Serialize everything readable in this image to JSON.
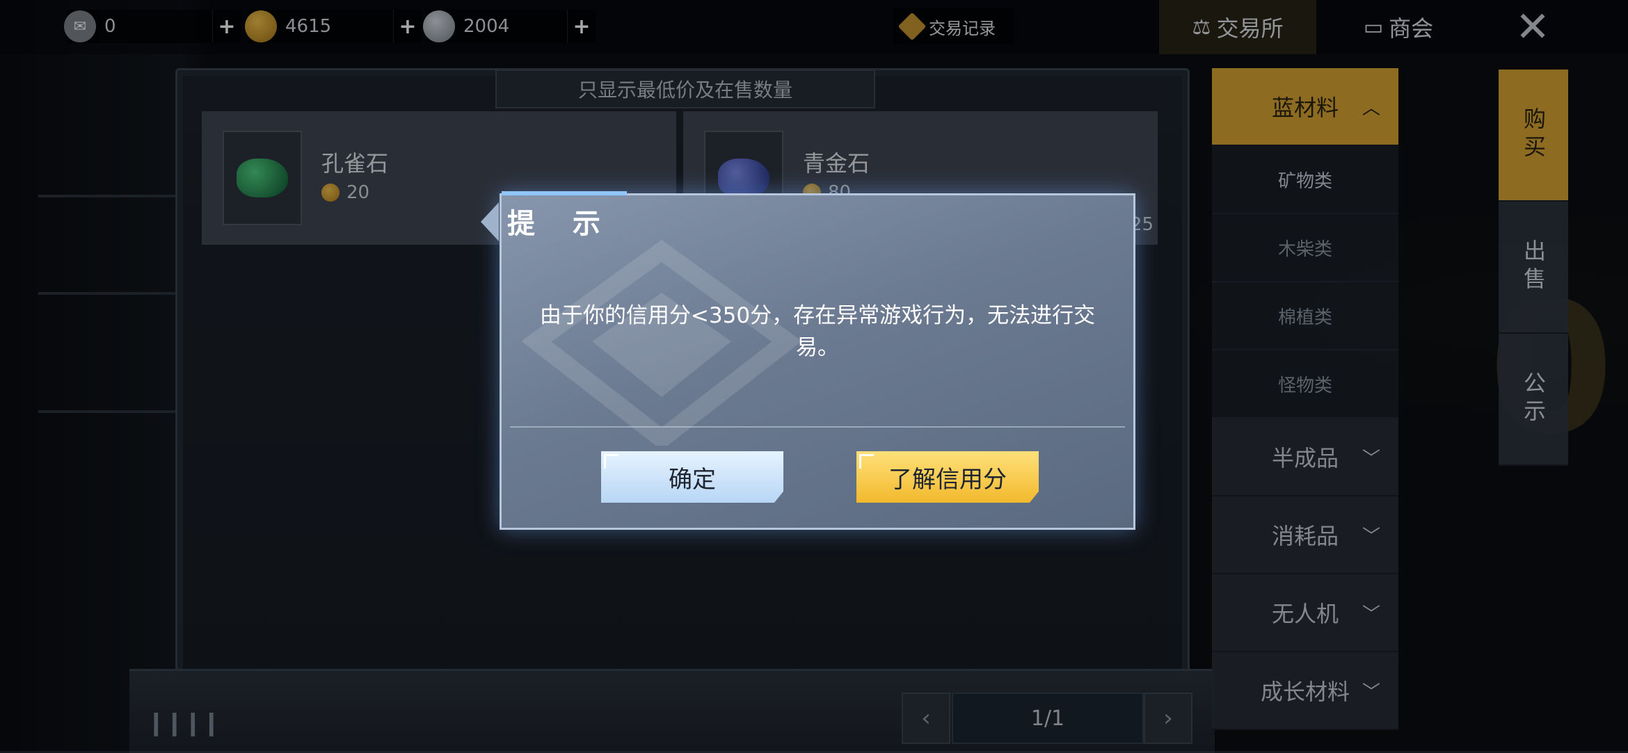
{
  "currency": [
    {
      "icon": "ticket-icon",
      "value": "0"
    },
    {
      "icon": "gold-coin-icon",
      "value": "4615"
    },
    {
      "icon": "silver-coin-icon",
      "value": "2004"
    }
  ],
  "topbar": {
    "trade_record": "交易记录",
    "tabs": [
      {
        "label": "交易所",
        "icon": "scale-icon"
      },
      {
        "label": "商会",
        "icon": "shop-icon"
      }
    ]
  },
  "panel": {
    "filter_label": "只显示最低价及在售数量",
    "items": [
      {
        "name": "孔雀石",
        "price": "20",
        "count": ""
      },
      {
        "name": "青金石",
        "price": "80",
        "count": "25"
      }
    ],
    "pager": "1/1"
  },
  "categories": [
    {
      "label": "蓝材料",
      "expanded": true
    },
    {
      "label": "矿物类"
    },
    {
      "label": "木柴类"
    },
    {
      "label": "棉植类"
    },
    {
      "label": "怪物类"
    },
    {
      "label": "半成品"
    },
    {
      "label": "消耗品"
    },
    {
      "label": "无人机"
    },
    {
      "label": "成长材料"
    }
  ],
  "side_tabs": [
    "购买",
    "出售",
    "公示"
  ],
  "modal": {
    "title": "提 示",
    "message": "由于你的信用分<350分，存在异常游戏行为，无法进行交易。",
    "confirm": "确定",
    "learn_credit": "了解信用分"
  },
  "colors": {
    "accent_gold": "#d9a532",
    "modal_bg": "#6b7a91",
    "confirm_btn": "#cfe4fb",
    "learn_btn": "#f7c94a"
  }
}
